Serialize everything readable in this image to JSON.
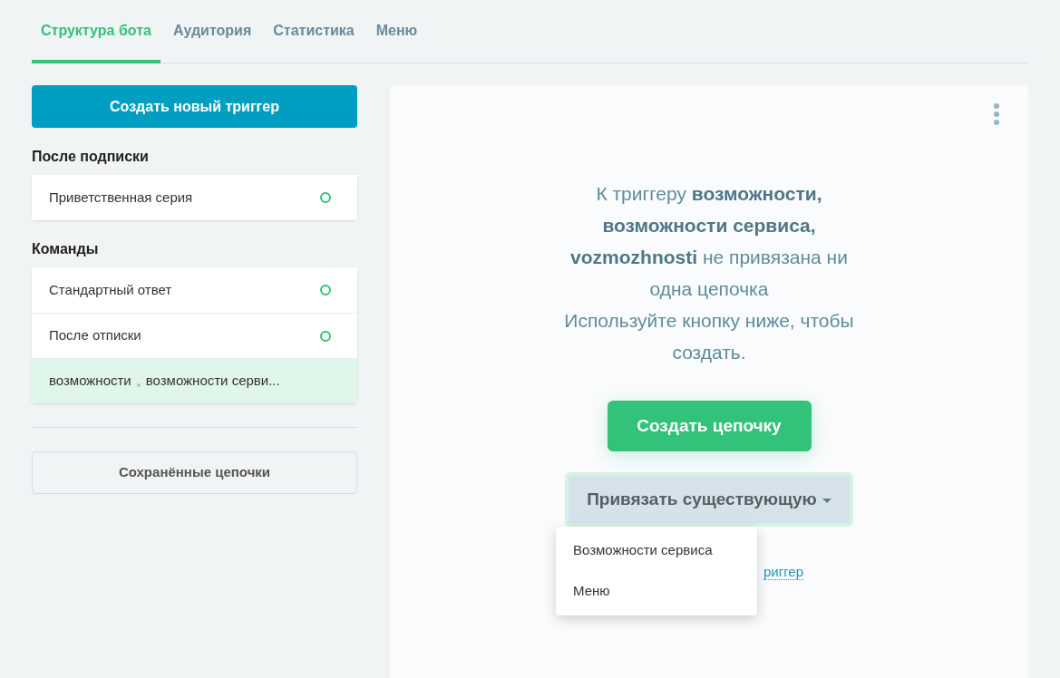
{
  "tabs": [
    {
      "label": "Структура бота",
      "selected": true
    },
    {
      "label": "Аудитория",
      "selected": false
    },
    {
      "label": "Статистика",
      "selected": false
    },
    {
      "label": "Меню",
      "selected": false
    }
  ],
  "create_trigger_button": "Создать новый триггер",
  "sections": [
    {
      "title": "После подписки",
      "items": [
        {
          "parts": [
            "Приветственная серия"
          ],
          "selected": false,
          "active": true
        }
      ]
    },
    {
      "title": "Команды",
      "items": [
        {
          "parts": [
            "Стандартный ответ"
          ],
          "selected": false,
          "active": true
        },
        {
          "parts": [
            "После отписки"
          ],
          "selected": false,
          "active": true
        },
        {
          "parts": [
            "возможности",
            "возможности серви..."
          ],
          "selected": true,
          "active": false
        }
      ]
    }
  ],
  "saved_chains_button": "Сохранённые цепочки",
  "panel": {
    "message": "К триггеру **возможности, возможности сервиса, vozmozhnosti** не привязана ни одна цепочка",
    "hint": "Используйте кнопку ниже, чтобы создать.",
    "create_chain_button": "Создать цепочку",
    "attach_button": "Привязать существующую",
    "link": "риггер",
    "dropdown": {
      "expanded": true,
      "options": [
        "Возможности сервиса",
        "Меню"
      ]
    }
  }
}
